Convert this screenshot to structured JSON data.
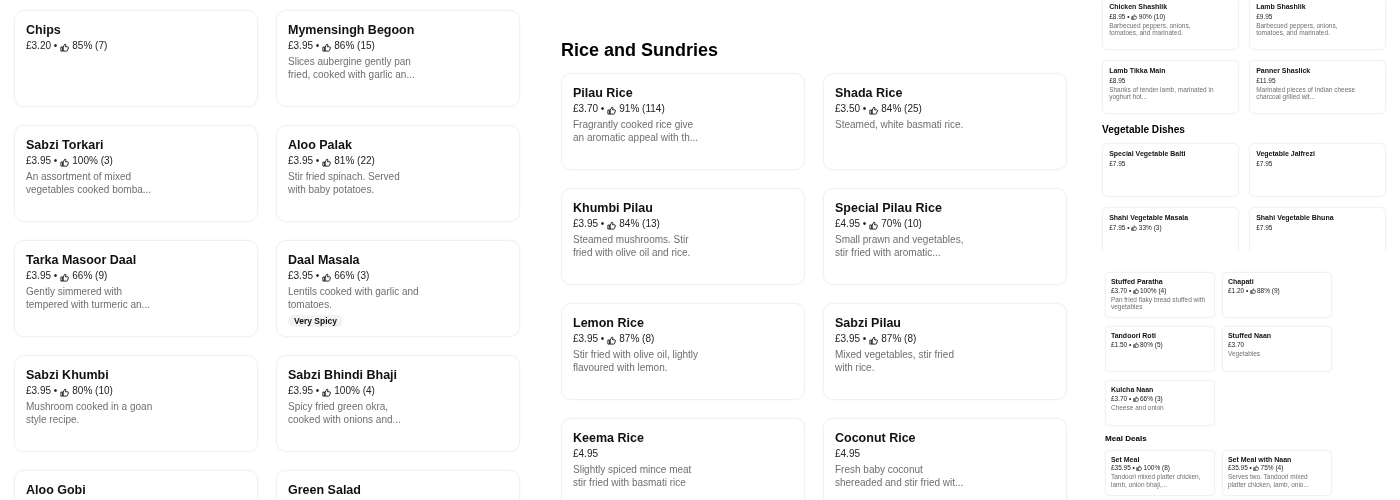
{
  "panels": [
    {
      "kind": "column",
      "sections": [
        {
          "items": [
            {
              "name": "Chips",
              "price": "£3.20 •",
              "rating": "85% (7)"
            },
            {
              "name": "Mymensingh Begoon",
              "price": "£3.95 •",
              "rating": "86% (15)",
              "description": "Slices aubergine gently pan fried, cooked with garlic an..."
            },
            {
              "name": "Sabzi Torkari",
              "price": "£3.95 •",
              "rating": "100% (3)",
              "description": "An assortment of mixed vegetables cooked bomba..."
            },
            {
              "name": "Aloo Palak",
              "price": "£3.95 •",
              "rating": "81% (22)",
              "description": "Stir fried spinach. Served with baby potatoes."
            },
            {
              "name": "Tarka Masoor Daal",
              "price": "£3.95 •",
              "rating": "66% (9)",
              "description": "Gently simmered with tempered with turmeric an..."
            },
            {
              "name": "Daal Masala",
              "price": "£3.95 •",
              "rating": "66% (3)",
              "description": "Lentils cooked with garlic and tomatoes.",
              "tags": [
                "Very Spicy"
              ]
            },
            {
              "name": "Sabzi Khumbi",
              "price": "£3.95 •",
              "rating": "80% (10)",
              "description": "Mushroom cooked in a goan style recipe."
            },
            {
              "name": "Sabzi Bhindi Bhaji",
              "price": "£3.95 •",
              "rating": "100% (4)",
              "description": "Spicy fried green okra, cooked with onions and..."
            },
            {
              "name": "Aloo Gobi"
            },
            {
              "name": "Green Salad"
            }
          ]
        }
      ]
    },
    {
      "kind": "column",
      "sections": [
        {
          "heading": "Rice and Sundries",
          "items": [
            {
              "name": "Pilau Rice",
              "price": "£3.70 •",
              "rating": "91% (114)",
              "description": "Fragrantly cooked rice give an aromatic appeal with th..."
            },
            {
              "name": "Shada Rice",
              "price": "£3.50 •",
              "rating": "84% (25)",
              "description": "Steamed, white basmati rice."
            },
            {
              "name": "Khumbi Pilau",
              "price": "£3.95 •",
              "rating": "84% (13)",
              "description": "Steamed mushrooms. Stir fried with olive oil and rice."
            },
            {
              "name": "Special Pilau Rice",
              "price": "£4.95 •",
              "rating": "70% (10)",
              "description": "Small prawn and vegetables, stir fried with aromatic..."
            },
            {
              "name": "Lemon Rice",
              "price": "£3.95 •",
              "rating": "87% (8)",
              "description": "Stir fried with olive oil, lightly flavoured with lemon."
            },
            {
              "name": "Sabzi Pilau",
              "price": "£3.95 •",
              "rating": "87% (8)",
              "description": "Mixed vegetables, stir fried with rice."
            },
            {
              "name": "Keema Rice",
              "price": "£4.95",
              "description": "Slightly spiced mince meat stir fried with basmati rice"
            },
            {
              "name": "Coconut Rice",
              "price": "£4.95",
              "description": "Fresh baby coconut shereaded and stir fried wit..."
            }
          ]
        }
      ]
    },
    {
      "kind": "preview-large",
      "sections": [
        {
          "items": [
            {
              "name": "Chicken Shashlik",
              "price": "£8.95 •",
              "rating": "90% (10)",
              "description": "Barbecued peppers, onions, tomatoes, and marinated."
            },
            {
              "name": "Lamb Shashlik",
              "price": "£9.95",
              "description": "Barbecued peppers, onions, tomatoes, and marinated."
            },
            {
              "name": "Lamb Tikka Main",
              "price": "£8.95",
              "description": "Shanks of tender lamb, marinated in yoghurt hot..."
            },
            {
              "name": "Panner Shaslick",
              "price": "£11.95",
              "description": "Marinated pieces of Indian cheese charcoal grilled wit..."
            }
          ]
        },
        {
          "heading": "Vegetable Dishes",
          "items": [
            {
              "name": "Special Vegetable Balti",
              "price": "£7.95"
            },
            {
              "name": "Vegetable Jalfrezi",
              "price": "£7.95"
            },
            {
              "name": "Shahi Vegetable Masala",
              "price": "£7.95 •",
              "rating": "33% (3)"
            },
            {
              "name": "Shahi Vegetable Bhuna",
              "price": "£7.95"
            }
          ]
        }
      ]
    },
    {
      "kind": "preview-small",
      "sections": [
        {
          "items": [
            {
              "name": "Stuffed Paratha",
              "price": "£3.70 •",
              "rating": "100% (4)",
              "description": "Pan fried flaky bread stuffed with vegetables"
            },
            {
              "name": "Chapati",
              "price": "£1.20 •",
              "rating": "88% (9)"
            },
            {
              "name": "Tandoori Roti",
              "price": "£1.50 •",
              "rating": "80% (5)"
            },
            {
              "name": "Stuffed Naan",
              "price": "£3.70",
              "description": "Vegetables"
            },
            {
              "name": "Kulcha Naan",
              "price": "£3.70 •",
              "rating": "66% (3)",
              "description": "Cheese and onion"
            }
          ]
        },
        {
          "heading": "Meal Deals",
          "items": [
            {
              "name": "Set Meal",
              "price": "£35.95 •",
              "rating": "100% (8)",
              "description": "Tandoori mixed platter chicken, lamb, onion bhaji,..."
            },
            {
              "name": "Set Meal with Naan",
              "price": "£35.95 •",
              "rating": "75% (4)",
              "description": "Serves two. Tandoori mixed platter chicken, lamb, onio..."
            }
          ]
        }
      ]
    }
  ]
}
